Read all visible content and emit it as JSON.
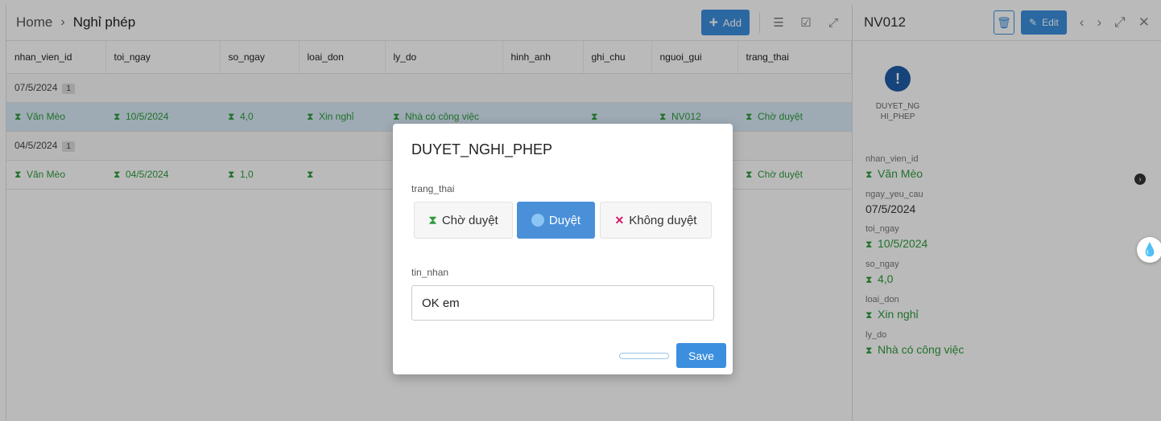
{
  "breadcrumb": {
    "home": "Home",
    "separator": "›",
    "page": "Nghỉ phép"
  },
  "toolbar": {
    "add_label": "Add",
    "add_icon": "+"
  },
  "columns": [
    "nhan_vien_id",
    "toi_ngay",
    "so_ngay",
    "loai_don",
    "ly_do",
    "hinh_anh",
    "ghi_chu",
    "nguoi_gui",
    "trang_thai"
  ],
  "groups": [
    {
      "label": "07/5/2024",
      "count": "1",
      "row": {
        "nhan_vien_id": "Văn Mèo",
        "toi_ngay": "10/5/2024",
        "so_ngay": "4,0",
        "loai_don": "Xin nghỉ",
        "ly_do": "Nhà có công việc",
        "hinh_anh": "",
        "ghi_chu": "",
        "nguoi_gui": "NV012",
        "trang_thai": "Chờ duyệt"
      }
    },
    {
      "label": "04/5/2024",
      "count": "1",
      "row": {
        "nhan_vien_id": "Văn Mèo",
        "toi_ngay": "04/5/2024",
        "so_ngay": "1,0",
        "loai_don": "",
        "ly_do": "",
        "hinh_anh": "",
        "ghi_chu": "",
        "nguoi_gui": "",
        "trang_thai": "Chờ duyệt"
      }
    }
  ],
  "detail": {
    "title": "NV012",
    "edit_label": "Edit",
    "action_label": "DUYET_NG HI_PHEP",
    "fields": [
      {
        "label": "nhan_vien_id",
        "value": "Văn Mèo"
      },
      {
        "label": "ngay_yeu_cau",
        "value": "07/5/2024"
      },
      {
        "label": "toi_ngay",
        "value": "10/5/2024"
      },
      {
        "label": "so_ngay",
        "value": "4,0"
      },
      {
        "label": "loai_don",
        "value": "Xin nghỉ"
      },
      {
        "label": "ly_do",
        "value": "Nhà có công việc"
      }
    ]
  },
  "modal": {
    "title": "DUYET_NGHI_PHEP",
    "status_label": "trang_thai",
    "options": [
      "Chờ duyệt",
      "Duyệt",
      "Không duyệt"
    ],
    "selected": "Duyệt",
    "message_label": "tin_nhan",
    "message_value": "OK em",
    "save_label": "Save"
  },
  "colors": {
    "accent": "#3c8fde",
    "status_green": "#2e9b3b",
    "reject": "#d4196a",
    "selected_row": "#d9ebf7"
  }
}
